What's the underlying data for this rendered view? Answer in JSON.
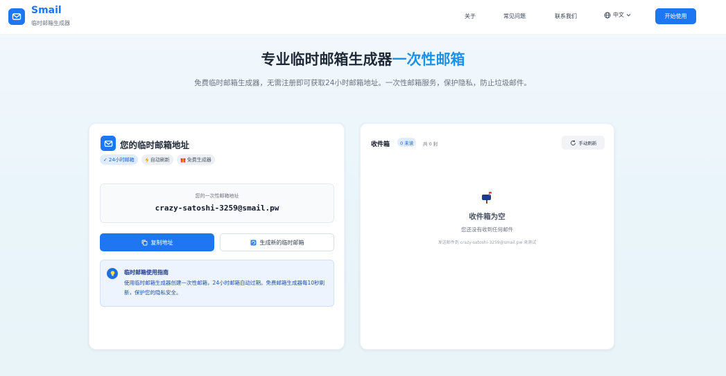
{
  "app": {
    "name": "Smail",
    "subtitle": "临时邮箱生成器",
    "icon": "mail-icon",
    "accent": "#1e76f2"
  },
  "nav": {
    "links": [
      {
        "label": "关于"
      },
      {
        "label": "常见问题"
      },
      {
        "label": "联系我们"
      }
    ],
    "language": {
      "label": "中文",
      "icon": "globe-icon"
    },
    "cta": "开始使用"
  },
  "hero": {
    "title_main": "专业临时邮箱生成器",
    "title_highlight": "一次性邮箱",
    "highlight_color": "#1e90e6",
    "description": "免费临时邮箱生成器，无需注册即可获取24小时邮箱地址。一次性邮箱服务，保护隐私，防止垃圾邮件。"
  },
  "address_card": {
    "title": "您的临时邮箱地址",
    "badges": [
      {
        "label": "24小时邮箱",
        "icon": "check-icon"
      },
      {
        "label": "自动刷新",
        "icon": "bolt-icon"
      },
      {
        "label": "免费生成器",
        "icon": "gift-icon"
      }
    ],
    "address_label": "您的一次性邮箱地址",
    "address": "crazy-satoshi-3259@smail.pw",
    "copy_button": "复制地址",
    "generate_button": "生成新的临时邮箱",
    "guide": {
      "title": "临时邮箱使用指南",
      "text": "使用临时邮箱生成器创建一次性邮箱，24小时邮箱自动过期。免费邮箱生成器每10秒刷新，保护您的隐私安全。"
    }
  },
  "inbox": {
    "title": "收件箱",
    "unread": "0 未读",
    "total": "共 0 封",
    "refresh_button": "手动刷新",
    "empty_title": "收件箱为空",
    "empty_subtitle": "您还没有收到任何邮件",
    "empty_hint": "发送邮件到 crazy-satoshi-3259@smail.pw 来测试"
  }
}
